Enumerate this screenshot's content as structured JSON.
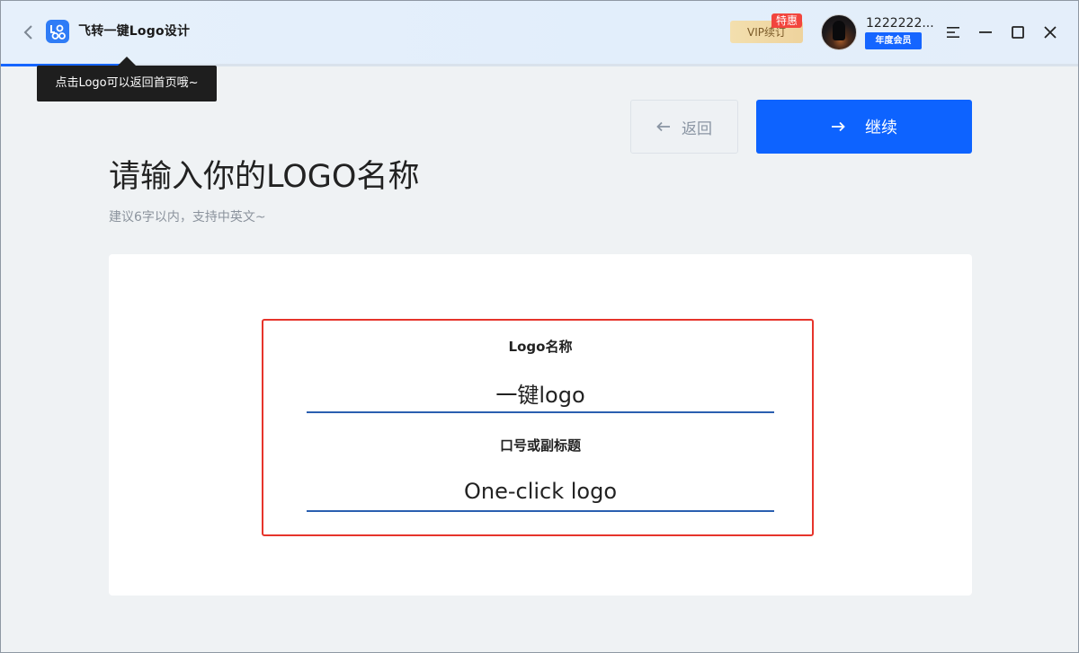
{
  "titlebar": {
    "app_title": "飞转一键Logo设计",
    "vip_label": "VIP续订",
    "vip_badge": "特惠",
    "user_name": "1222222...",
    "member_badge": "年度会员"
  },
  "progress": {
    "fraction": 0.12
  },
  "tooltip": {
    "text": "点击Logo可以返回首页哦~"
  },
  "nav": {
    "back_label": "返回",
    "continue_label": "继续"
  },
  "page": {
    "heading": "请输入你的LOGO名称",
    "subheading": "建议6字以内，支持中英文~"
  },
  "form": {
    "name_label": "Logo名称",
    "name_value": "一键logo",
    "slogan_label": "口号或副标题",
    "slogan_value": "One-click logo"
  },
  "colors": {
    "accent": "#0d63ff",
    "highlight_border": "#e6342b",
    "input_underline": "#2a5fb0"
  },
  "icons": {
    "back": "chevron-left-icon",
    "app": "logo-app-icon",
    "menu": "menu-icon",
    "minimize": "minimize-icon",
    "maximize": "maximize-icon",
    "close": "close-icon",
    "arrow_left": "arrow-left-icon",
    "arrow_right": "arrow-right-icon"
  }
}
